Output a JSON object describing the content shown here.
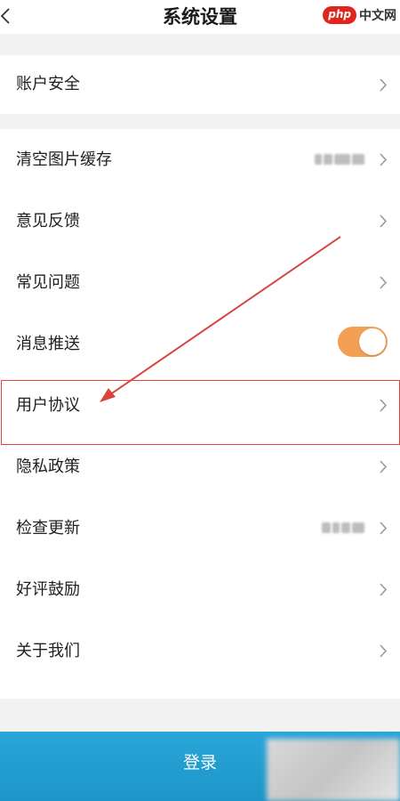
{
  "header": {
    "title": "系统设置",
    "back_icon": "chevron-left-icon",
    "watermark_logo": "php",
    "watermark_text": "中文网"
  },
  "groups": [
    {
      "items": [
        {
          "label": "账户安全",
          "icon": "chevron-right-icon"
        }
      ]
    },
    {
      "items": [
        {
          "label": "清空图片缓存",
          "value": "1.19MB",
          "value_blurred": true,
          "icon": "chevron-right-icon"
        },
        {
          "label": "意见反馈",
          "icon": "chevron-right-icon"
        },
        {
          "label": "常见问题",
          "icon": "chevron-right-icon"
        },
        {
          "label": "消息推送",
          "toggle_on": true
        },
        {
          "label": "用户协议",
          "icon": "chevron-right-icon",
          "highlighted": true
        },
        {
          "label": "隐私政策",
          "icon": "chevron-right-icon"
        },
        {
          "label": "检查更新",
          "value": "3.7.5",
          "value_blurred": true,
          "icon": "chevron-right-icon"
        },
        {
          "label": "好评鼓励",
          "icon": "chevron-right-icon"
        },
        {
          "label": "关于我们",
          "icon": "chevron-right-icon"
        }
      ]
    }
  ],
  "login_button": {
    "label": "登录"
  },
  "colors": {
    "accent_toggle": "#f2a154",
    "login_bg": "#1d95c9",
    "highlight_border": "#e0463e",
    "background": "#f2f2f2"
  }
}
